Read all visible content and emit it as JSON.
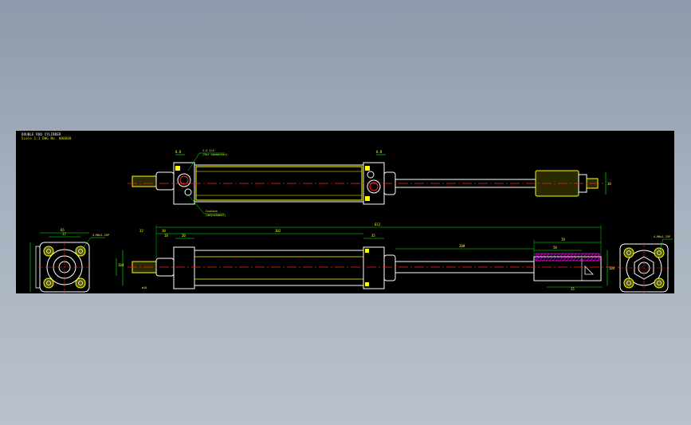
{
  "drawing": {
    "title_line_1": "DOUBLE ROD CYLINDER",
    "title_line_2": "Scale 1:1  DWG No. 000000",
    "colors": {
      "background": "#000000",
      "outline": "#ffffff",
      "body": "#ffff00",
      "dimension": "#00ff00",
      "centerline": "#ff2020",
      "hatch": "#ff00ff",
      "note": "#ffff00"
    },
    "dimensions": {
      "d_overall": "612",
      "d_body": "302",
      "d_stroke": "200",
      "d_cap_a": "32",
      "d_cap_b": "30",
      "d_flange_a": "18",
      "d_flange_b": "20",
      "d_head": "35",
      "d_clevis_a": "78",
      "d_clevis_b": "50",
      "d_clevis_bottom": "25",
      "d_right_height": "104",
      "d_left_height": "104",
      "d_rod_side": "30",
      "d_top_a": "8.8",
      "d_top_b": "8.8",
      "d_end_view_w": "65",
      "d_end_view_inner": "17"
    },
    "notes": {
      "note_top_1": "2-G 1/4",
      "note_top_2": "(for connector)",
      "note_bottom_1": "Cushion",
      "note_bottom_2": "(adjustment)",
      "note_left_end": "4-M8x1.25P",
      "note_right_end": "4-M8x1.25P",
      "note_small_left": "ø10"
    }
  }
}
